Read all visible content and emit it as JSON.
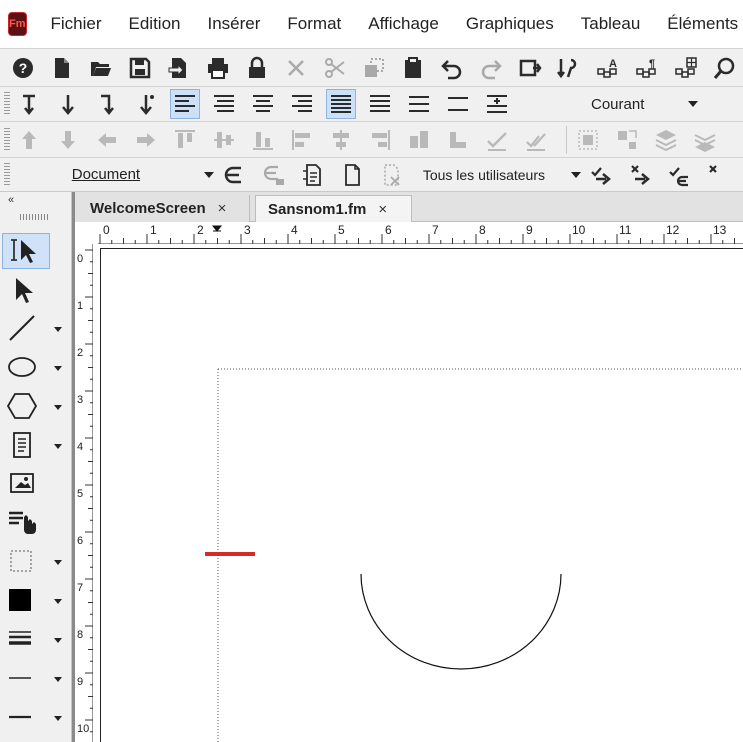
{
  "app": {
    "logo_text": "Fm",
    "brand_color": "#c12b2b"
  },
  "menu": [
    "Fichier",
    "Edition",
    "Insérer",
    "Format",
    "Affichage",
    "Graphiques",
    "Tableau",
    "Éléments"
  ],
  "toolbar": {
    "paragraph_style": "Courant",
    "view_mode": "Document",
    "users_filter": "Tous les utilisateurs"
  },
  "tabs": [
    {
      "label": "WelcomeScreen",
      "close": "×"
    },
    {
      "label": "Sansnom1.fm",
      "close": "×"
    }
  ],
  "left_panel": {
    "collapse_label": "«"
  },
  "ruler": {
    "horizontal": [
      "0",
      "1",
      "2",
      "3",
      "4",
      "5",
      "6",
      "7",
      "8",
      "9",
      "10",
      "11",
      "12",
      "13"
    ],
    "vertical": [
      "0",
      "1",
      "2",
      "3",
      "4",
      "5",
      "6",
      "7",
      "8",
      "9",
      "10"
    ]
  },
  "colors": {
    "active_tab": "#f4f4f4",
    "selection": "#cfe2f8",
    "red_marker": "#d42a2a"
  }
}
